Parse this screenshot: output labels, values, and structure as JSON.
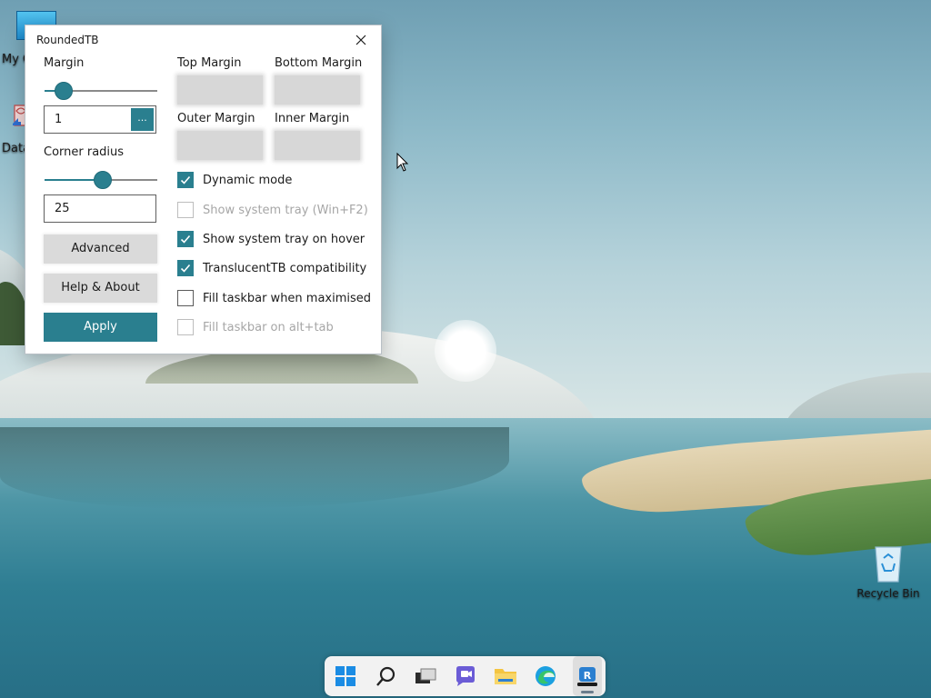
{
  "window": {
    "title": "RoundedTB",
    "close_icon": "close-icon"
  },
  "margin": {
    "label": "Margin",
    "slider_fraction": 0.11,
    "value": "1",
    "dots_label": "..."
  },
  "corner_radius": {
    "label": "Corner radius",
    "slider_fraction": 0.52,
    "value": "25"
  },
  "buttons": {
    "advanced": "Advanced",
    "help_about": "Help & About",
    "apply": "Apply"
  },
  "margins_grid": {
    "top": "Top Margin",
    "bottom": "Bottom Margin",
    "outer": "Outer Margin",
    "inner": "Inner Margin"
  },
  "options": [
    {
      "label": "Dynamic mode",
      "checked": true,
      "enabled": true
    },
    {
      "label": "Show system tray (Win+F2)",
      "checked": false,
      "enabled": false
    },
    {
      "label": "Show system tray on hover",
      "checked": true,
      "enabled": true
    },
    {
      "label": "TranslucentTB compatibility",
      "checked": true,
      "enabled": true
    },
    {
      "label": "Fill taskbar when maximised",
      "checked": false,
      "enabled": true
    },
    {
      "label": "Fill taskbar on alt+tab",
      "checked": false,
      "enabled": false
    }
  ],
  "desktop": {
    "icons": [
      {
        "name": "My C",
        "icon": "computer-icon"
      },
      {
        "name": "Data",
        "icon": "shortcut-icon"
      },
      {
        "name": "Recycle Bin",
        "icon": "recycle-bin-icon"
      }
    ]
  },
  "taskbar": {
    "items": [
      "start-icon",
      "search-icon",
      "task-view-icon",
      "chat-icon",
      "file-explorer-icon",
      "edge-icon",
      "roundedtb-icon"
    ],
    "colors": {
      "accent": "#2a7f8f",
      "start": "#1b8ce4",
      "folder": "#f4c542",
      "edge": "#1ca0e0"
    }
  }
}
